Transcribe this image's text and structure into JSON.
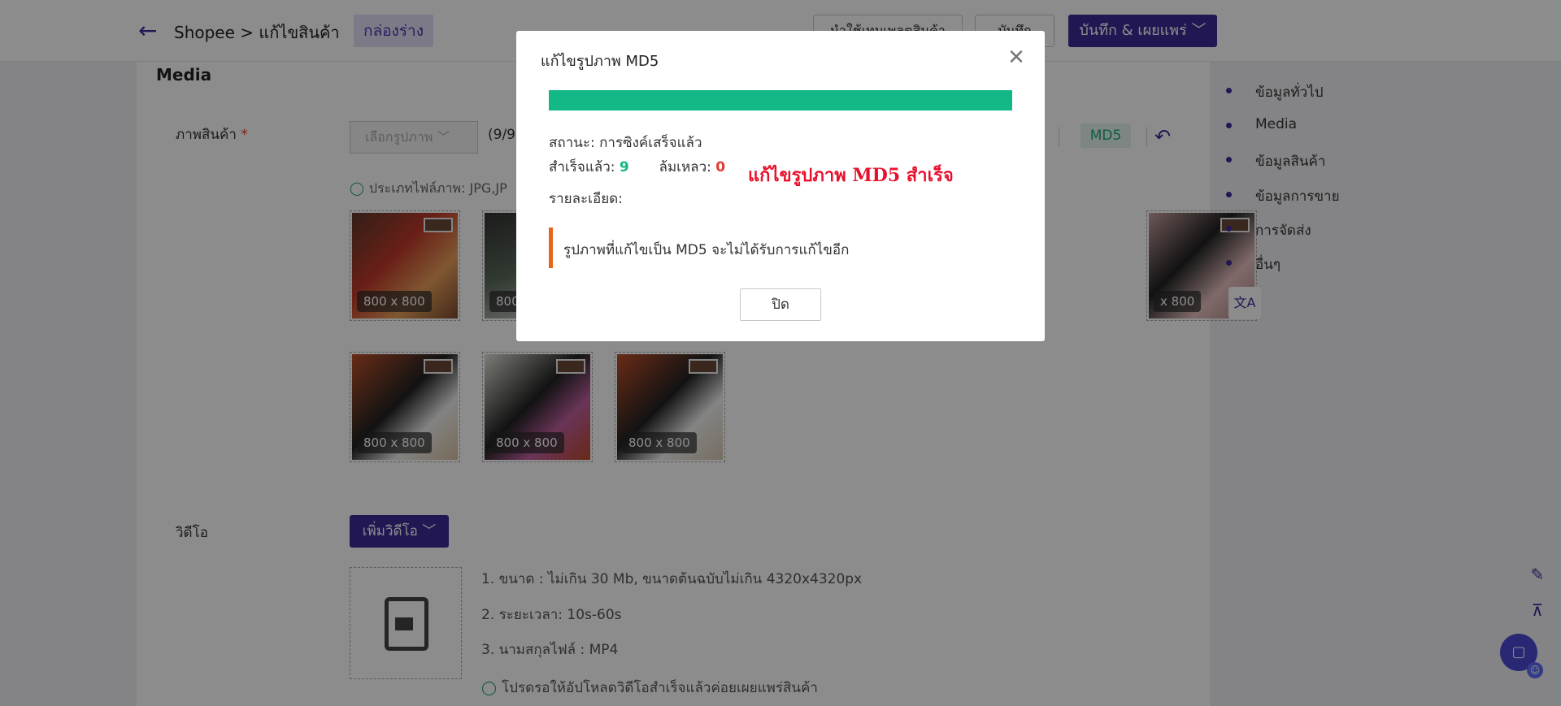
{
  "header": {
    "breadcrumb": "Shopee > แก้ไขสินค้า",
    "draft_badge": "กล่องร่าง",
    "btn_apply_template": "นำใช้เทมเพลตสินค้า",
    "btn_save": "บันทึก",
    "btn_save_publish": "บันทึก & เผยแพร่ ﹀"
  },
  "main": {
    "section_title": "Media",
    "product_images_label": "ภาพสินค้า",
    "required_mark": "*",
    "select_image_placeholder": "เลือกรูปภาพ ﹀",
    "image_count": "(9/9",
    "file_type_hint": "ประเภทไฟล์ภาพ: JPG,JP",
    "md5_tag": "MD5",
    "thumbnails": [
      {
        "size": "800 x 800"
      },
      {
        "size": "800"
      },
      {
        "size": "x 800"
      },
      {
        "size": "800 x 800"
      },
      {
        "size": "800 x 800"
      },
      {
        "size": "800 x 800"
      }
    ],
    "video_label": "วิดีโอ",
    "add_video_button": "เพิ่มวิดีโอ ﹀",
    "video_info": [
      "1. ขนาด : ไม่เกิน 30 Mb, ขนาดต้นฉบับไม่เกิน 4320x4320px",
      "2. ระยะเวลา: 10s-60s",
      "3. นามสกุลไฟล์ : MP4",
      "โปรดรอให้อัปโหลดวิดีโอสำเร็จแล้วค่อยเผยแพร่สินค้า"
    ]
  },
  "side_nav": {
    "items": [
      "ข้อมูลทั่วไป",
      "Media",
      "ข้อมูลสินค้า",
      "ข้อมูลการขาย",
      "การจัดส่ง",
      "อื่นๆ"
    ],
    "translate_icon": "translate-icon"
  },
  "modal": {
    "title": "แก้ไขรูปภาพ MD5",
    "progress": 1.0,
    "status_label": "สถานะ:",
    "status_value": "การซิงค์เสร็จแล้ว",
    "success_label": "สำเร็จแล้ว:",
    "success_count": "9",
    "fail_label": "ล้มเหลว:",
    "fail_count": "0",
    "detail_label": "รายละเอียด:",
    "success_message": "แก้ไขรูปภาพ MD5 สำเร็จ",
    "warning_text": "รูปภาพที่แก้ไขเป็น MD5 จะไม่ได้รับการแก้ไขอีก",
    "close_button": "ปิด"
  },
  "colors": {
    "brand": "#3c2a98",
    "progress": "#12b886",
    "warning_bar": "#e8661c",
    "success_message": "#e8112d"
  }
}
